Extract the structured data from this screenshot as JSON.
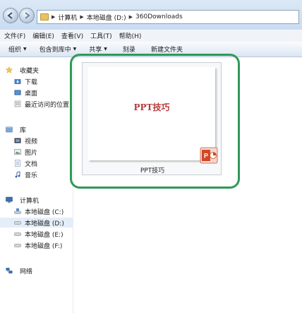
{
  "address_bar": {
    "crumbs": [
      "计算机",
      "本地磁盘 (D:)",
      "360Downloads"
    ]
  },
  "menu": {
    "items": [
      "文件(F)",
      "编辑(E)",
      "查看(V)",
      "工具(T)",
      "帮助(H)"
    ]
  },
  "toolbar": {
    "organize": "组织",
    "include_in_library": "包含到库中",
    "share": "共享",
    "burn": "刻录",
    "new_folder": "新建文件夹"
  },
  "sidebar": {
    "favorites": {
      "label": "收藏夹",
      "items": [
        "下载",
        "桌面",
        "最近访问的位置"
      ]
    },
    "libraries": {
      "label": "库",
      "items": [
        "视频",
        "图片",
        "文档",
        "音乐"
      ]
    },
    "computer": {
      "label": "计算机",
      "items": [
        "本地磁盘 (C:)",
        "本地磁盘 (D:)",
        "本地磁盘 (E:)",
        "本地磁盘 (F:)"
      ]
    },
    "network": {
      "label": "网络"
    }
  },
  "file": {
    "slide_title": "PPT技巧",
    "caption": "PPT技巧"
  },
  "colors": {
    "highlight": "#2e9a57",
    "slide_title": "#b83a3a",
    "ppt_icon": "#d24726"
  }
}
